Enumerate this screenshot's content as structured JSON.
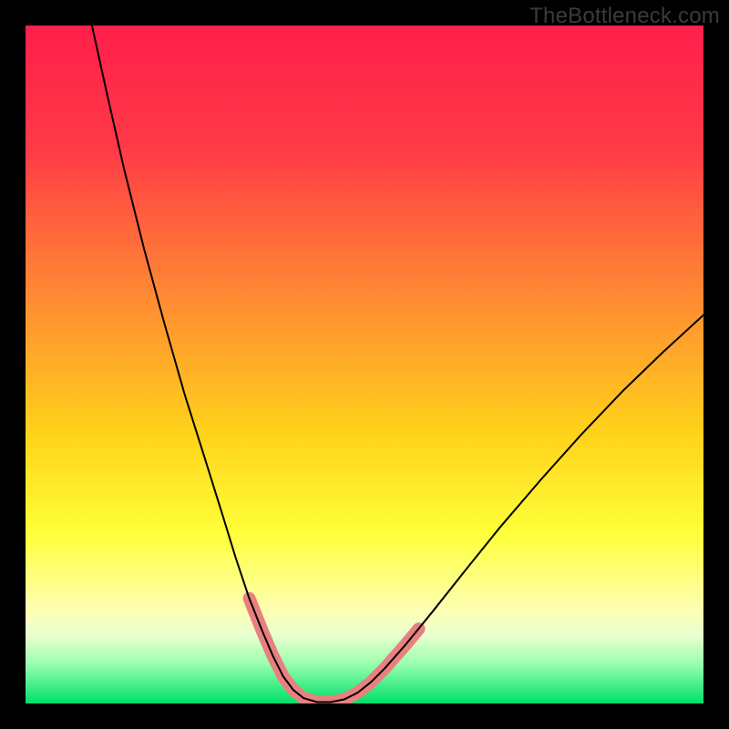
{
  "watermark": "TheBottleneck.com",
  "chart_data": {
    "type": "line",
    "title": "",
    "xlabel": "",
    "ylabel": "",
    "xlim": [
      0,
      100
    ],
    "ylim": [
      0,
      100
    ],
    "grid": false,
    "gradient_stops": [
      {
        "offset": 0,
        "color": "#ff1f4b"
      },
      {
        "offset": 18,
        "color": "#ff3a47"
      },
      {
        "offset": 40,
        "color": "#ff8a33"
      },
      {
        "offset": 60,
        "color": "#ffd21a"
      },
      {
        "offset": 75,
        "color": "#ffff3a"
      },
      {
        "offset": 86,
        "color": "#feffb0"
      },
      {
        "offset": 90,
        "color": "#e8ffcf"
      },
      {
        "offset": 94,
        "color": "#9dffb0"
      },
      {
        "offset": 100,
        "color": "#00e06a"
      }
    ],
    "series": [
      {
        "name": "bottleneck-curve",
        "stroke": "#000000",
        "points": [
          {
            "x": 9.8,
            "y": 100.0
          },
          {
            "x": 12.0,
            "y": 90.0
          },
          {
            "x": 14.5,
            "y": 79.0
          },
          {
            "x": 17.5,
            "y": 67.0
          },
          {
            "x": 20.5,
            "y": 56.0
          },
          {
            "x": 23.5,
            "y": 45.5
          },
          {
            "x": 26.5,
            "y": 36.0
          },
          {
            "x": 29.0,
            "y": 28.0
          },
          {
            "x": 31.0,
            "y": 21.5
          },
          {
            "x": 33.0,
            "y": 15.5
          },
          {
            "x": 35.0,
            "y": 10.5
          },
          {
            "x": 36.5,
            "y": 7.0
          },
          {
            "x": 38.0,
            "y": 4.0
          },
          {
            "x": 39.5,
            "y": 2.0
          },
          {
            "x": 41.0,
            "y": 0.8
          },
          {
            "x": 43.0,
            "y": 0.2
          },
          {
            "x": 45.0,
            "y": 0.2
          },
          {
            "x": 47.0,
            "y": 0.6
          },
          {
            "x": 49.0,
            "y": 1.6
          },
          {
            "x": 51.0,
            "y": 3.2
          },
          {
            "x": 53.0,
            "y": 5.2
          },
          {
            "x": 56.0,
            "y": 8.6
          },
          {
            "x": 60.0,
            "y": 13.5
          },
          {
            "x": 65.0,
            "y": 19.8
          },
          {
            "x": 70.0,
            "y": 26.0
          },
          {
            "x": 76.0,
            "y": 33.0
          },
          {
            "x": 82.0,
            "y": 39.7
          },
          {
            "x": 88.0,
            "y": 46.0
          },
          {
            "x": 94.0,
            "y": 51.8
          },
          {
            "x": 100.0,
            "y": 57.3
          }
        ]
      },
      {
        "name": "highlight-left",
        "stroke": "#e98080",
        "stroke_width": 14,
        "points": [
          {
            "x": 33.0,
            "y": 15.5
          },
          {
            "x": 35.0,
            "y": 10.5
          },
          {
            "x": 36.5,
            "y": 7.0
          },
          {
            "x": 38.0,
            "y": 4.0
          },
          {
            "x": 39.5,
            "y": 2.0
          },
          {
            "x": 41.0,
            "y": 0.8
          },
          {
            "x": 43.0,
            "y": 0.2
          },
          {
            "x": 45.0,
            "y": 0.2
          },
          {
            "x": 47.0,
            "y": 0.6
          },
          {
            "x": 49.0,
            "y": 1.6
          }
        ]
      },
      {
        "name": "highlight-right",
        "stroke": "#e98080",
        "stroke_width": 14,
        "points": [
          {
            "x": 49.0,
            "y": 1.6
          },
          {
            "x": 51.0,
            "y": 3.2
          },
          {
            "x": 53.0,
            "y": 5.2
          },
          {
            "x": 56.0,
            "y": 8.6
          },
          {
            "x": 58.0,
            "y": 11.0
          }
        ]
      }
    ]
  }
}
